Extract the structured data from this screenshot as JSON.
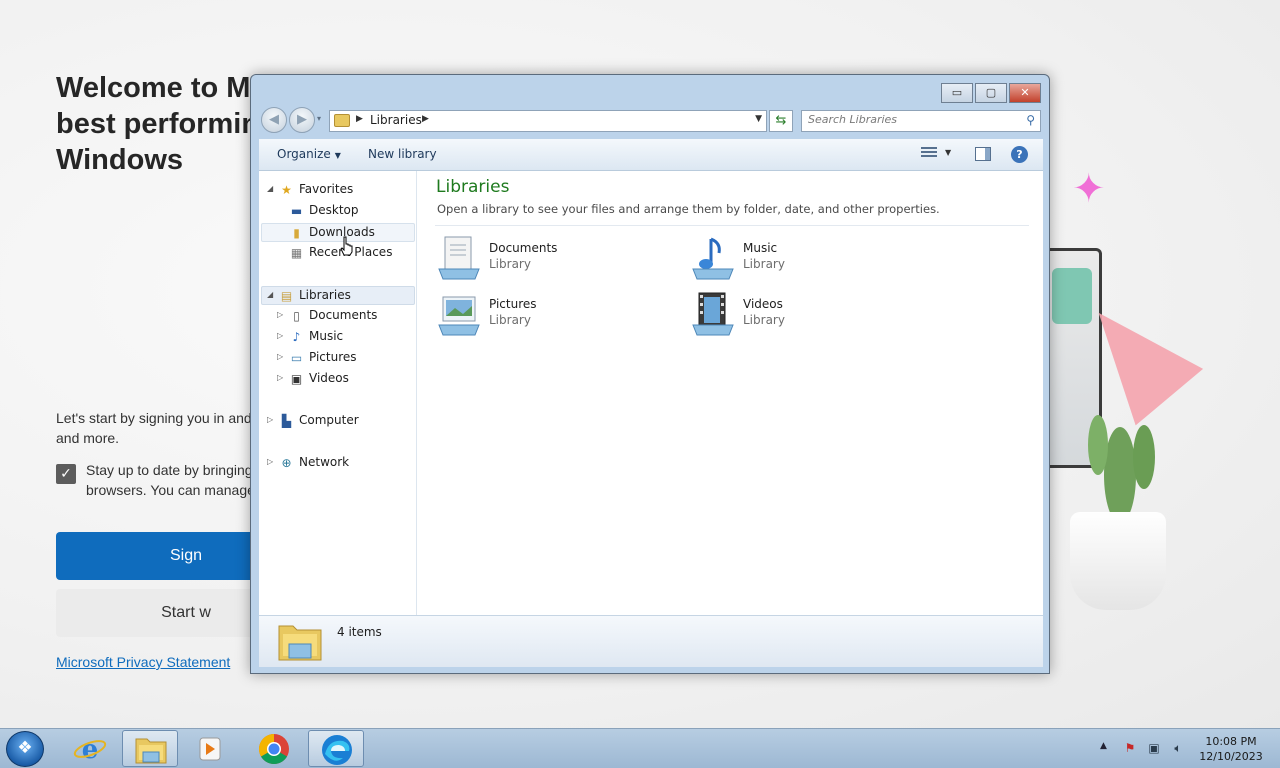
{
  "edge_welcome": {
    "title": "Welcome to Microsoft Edge, the best performing browser on Windows",
    "title_visible": "Welcome to Mi\nbest performing\nWindows",
    "signin_prompt": "Let's start by signing you in and",
    "signin_prompt_2": "and more.",
    "sync_text_1": "Stay up to date by bringing",
    "sync_text_2": "browsers. You can manage",
    "sign_in_button": "Sign",
    "start_button": "Start w",
    "privacy_link": "Microsoft Privacy Statement",
    "sync_checked": true
  },
  "explorer": {
    "window_controls": {
      "minimize": "▭",
      "maximize": "▢",
      "close": "✕"
    },
    "address": {
      "crumb": "Libraries",
      "recent_arrow": "▾"
    },
    "search": {
      "placeholder": "Search Libraries"
    },
    "toolbar": {
      "organize": "Organize",
      "new_library": "New library",
      "help": "?"
    },
    "nav_tree": {
      "favorites": "Favorites",
      "desktop": "Desktop",
      "downloads": "Downloads",
      "recent_places": "Recent Places",
      "libraries": "Libraries",
      "documents": "Documents",
      "music": "Music",
      "pictures": "Pictures",
      "videos": "Videos",
      "computer": "Computer",
      "network": "Network"
    },
    "content": {
      "title": "Libraries",
      "description": "Open a library to see your files and arrange them by folder, date, and other properties.",
      "items": [
        {
          "name": "Documents",
          "type": "Library",
          "icon": "documents-library-icon"
        },
        {
          "name": "Music",
          "type": "Library",
          "icon": "music-library-icon"
        },
        {
          "name": "Pictures",
          "type": "Library",
          "icon": "pictures-library-icon"
        },
        {
          "name": "Videos",
          "type": "Library",
          "icon": "videos-library-icon"
        }
      ]
    },
    "details": {
      "count": "4 items"
    }
  },
  "taskbar": {
    "apps": [
      "internet-explorer",
      "windows-explorer",
      "windows-media-player",
      "google-chrome",
      "microsoft-edge"
    ],
    "clock": {
      "time": "10:08 PM",
      "date": "12/10/2023"
    }
  },
  "colors": {
    "accent_blue": "#0f6cbd",
    "library_title_green": "#1e7a1e",
    "taskbar": "#a9c3dc",
    "close_button": "#c2412c"
  }
}
